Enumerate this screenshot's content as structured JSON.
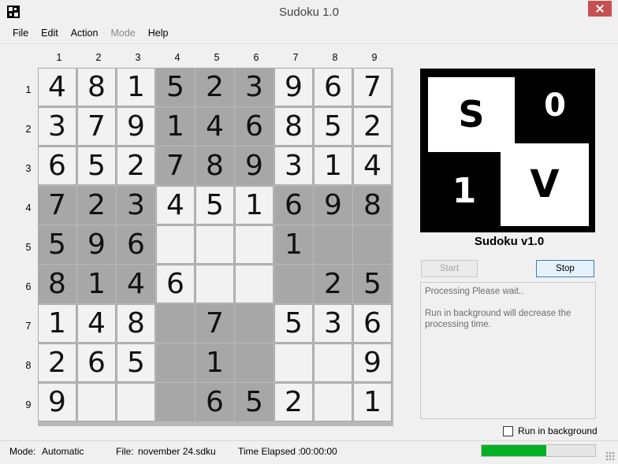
{
  "window": {
    "title": "Sudoku 1.0"
  },
  "menu": [
    {
      "label": "File",
      "enabled": true
    },
    {
      "label": "Edit",
      "enabled": true
    },
    {
      "label": "Action",
      "enabled": true
    },
    {
      "label": "Mode",
      "enabled": false
    },
    {
      "label": "Help",
      "enabled": true
    }
  ],
  "board": {
    "column_labels": [
      "1",
      "2",
      "3",
      "4",
      "5",
      "6",
      "7",
      "8",
      "9"
    ],
    "row_labels": [
      "1",
      "2",
      "3",
      "4",
      "5",
      "6",
      "7",
      "8",
      "9"
    ],
    "cells": [
      [
        "4",
        "8",
        "1",
        "5",
        "2",
        "3",
        "9",
        "6",
        "7"
      ],
      [
        "3",
        "7",
        "9",
        "1",
        "4",
        "6",
        "8",
        "5",
        "2"
      ],
      [
        "6",
        "5",
        "2",
        "7",
        "8",
        "9",
        "3",
        "1",
        "4"
      ],
      [
        "7",
        "2",
        "3",
        "4",
        "5",
        "1",
        "6",
        "9",
        "8"
      ],
      [
        "5",
        "9",
        "6",
        "",
        "",
        "",
        "1",
        "",
        ""
      ],
      [
        "8",
        "1",
        "4",
        "6",
        "",
        "",
        "",
        "2",
        "5"
      ],
      [
        "1",
        "4",
        "8",
        "",
        "7",
        "",
        "5",
        "3",
        "6"
      ],
      [
        "2",
        "6",
        "5",
        "",
        "1",
        "",
        "",
        "",
        "9"
      ],
      [
        "9",
        "",
        "",
        "",
        "6",
        "5",
        "2",
        "",
        "1"
      ]
    ],
    "shaded": [
      [
        0,
        0,
        0,
        1,
        1,
        1,
        0,
        0,
        0
      ],
      [
        0,
        0,
        0,
        1,
        1,
        1,
        0,
        0,
        0
      ],
      [
        0,
        0,
        0,
        1,
        1,
        1,
        0,
        0,
        0
      ],
      [
        1,
        1,
        1,
        0,
        0,
        0,
        1,
        1,
        1
      ],
      [
        1,
        1,
        1,
        0,
        0,
        0,
        1,
        1,
        1
      ],
      [
        1,
        1,
        1,
        0,
        0,
        0,
        1,
        1,
        1
      ],
      [
        0,
        0,
        0,
        1,
        1,
        1,
        0,
        0,
        0
      ],
      [
        0,
        0,
        0,
        1,
        1,
        1,
        0,
        0,
        0
      ],
      [
        0,
        0,
        0,
        1,
        1,
        1,
        0,
        0,
        0
      ]
    ]
  },
  "logo": {
    "tiles": [
      "S",
      "0",
      "1",
      "V"
    ],
    "caption": "Sudoku v1.0"
  },
  "buttons": {
    "start": "Start",
    "stop": "Stop"
  },
  "messages": [
    "Processing Please wait..",
    "Run in background will decrease the processing time."
  ],
  "run_in_background": {
    "label": "Run in background",
    "checked": false
  },
  "status": {
    "mode_label": "Mode:",
    "mode_value": "Automatic",
    "file_label": "File:",
    "file_value": "november 24.sdku",
    "time_label": "Time Elapsed :",
    "time_value": "00:00:00",
    "progress_percent": 57
  },
  "colors": {
    "shaded_cell": "#a7a7a7",
    "light_cell": "#f2f2f2",
    "progress_fill": "#06b025"
  }
}
